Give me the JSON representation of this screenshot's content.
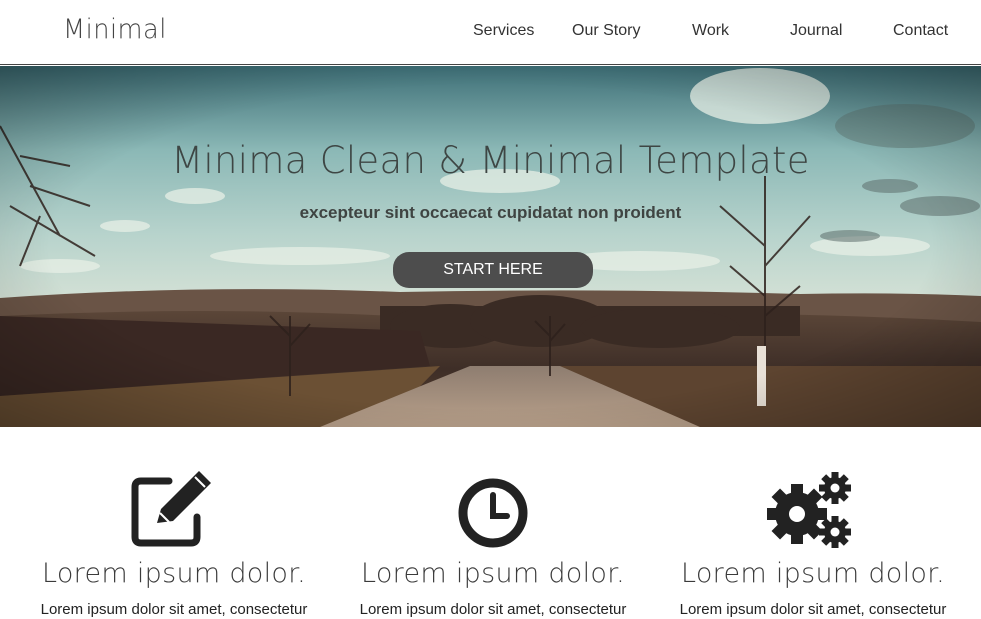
{
  "header": {
    "logo": "Minimal",
    "nav": [
      {
        "label": "Services"
      },
      {
        "label": "Our Story"
      },
      {
        "label": "Work"
      },
      {
        "label": "Journal"
      },
      {
        "label": "Contact"
      }
    ]
  },
  "hero": {
    "title": "Minima Clean & Minimal Template",
    "subtitle": "excepteur sint occaecat cupidatat non proident",
    "cta_label": "START HERE"
  },
  "features": [
    {
      "icon": "edit-icon",
      "title": "Lorem ipsum dolor.",
      "text": "Lorem ipsum dolor sit amet, consectetur"
    },
    {
      "icon": "clock-icon",
      "title": "Lorem ipsum dolor.",
      "text": "Lorem ipsum dolor sit amet, consectetur"
    },
    {
      "icon": "gears-icon",
      "title": "Lorem ipsum dolor.",
      "text": "Lorem ipsum dolor sit amet, consectetur"
    }
  ],
  "colors": {
    "header_bg": "#ffffff",
    "button_bg": "#4d4d4d",
    "text_dark": "#333333",
    "sky": "#8fb7b3",
    "field": "#4a3a30"
  }
}
